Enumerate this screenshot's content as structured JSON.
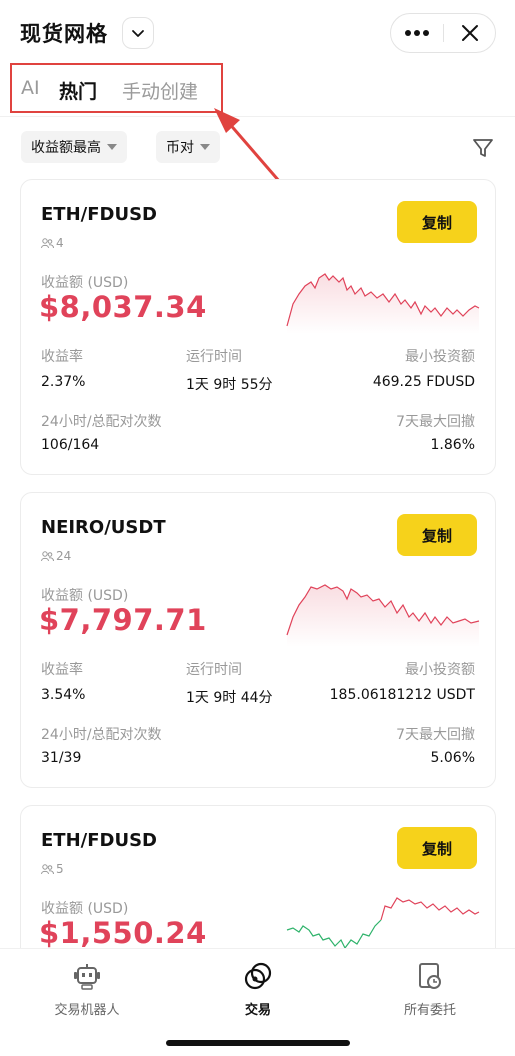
{
  "header": {
    "title": "现货网格",
    "icons": [
      "chevron-down-icon",
      "more-icon",
      "close-icon"
    ]
  },
  "tabs": [
    {
      "label": "AI",
      "active": false
    },
    {
      "label": "热门",
      "active": true
    },
    {
      "label": "手动创建",
      "active": false
    }
  ],
  "filters": {
    "sort_label": "收益额最高",
    "pair_label": "币对",
    "filter_icon": "filter-icon"
  },
  "cards": [
    {
      "pair": "ETH/FDUSD",
      "users": "4",
      "copy_label": "复制",
      "pnl_label": "收益额 (USD)",
      "pnl_value": "$8,037.34",
      "roi_label": "收益率",
      "roi_value": "2.37%",
      "runtime_label": "运行时间",
      "runtime_value": "1天 9时 55分",
      "min_invest_label": "最小投资额",
      "min_invest_value": "469.25 FDUSD",
      "trades_label": "24小时/总配对次数",
      "trades_value": "106/164",
      "drawdown_label": "7天最大回撤",
      "drawdown_value": "1.86%"
    },
    {
      "pair": "NEIRO/USDT",
      "users": "24",
      "copy_label": "复制",
      "pnl_label": "收益额 (USD)",
      "pnl_value": "$7,797.71",
      "roi_label": "收益率",
      "roi_value": "3.54%",
      "runtime_label": "运行时间",
      "runtime_value": "1天 9时 44分",
      "min_invest_label": "最小投资额",
      "min_invest_value": "185.06181212 USDT",
      "trades_label": "24小时/总配对次数",
      "trades_value": "31/39",
      "drawdown_label": "7天最大回撤",
      "drawdown_value": "5.06%"
    },
    {
      "pair": "ETH/FDUSD",
      "users": "5",
      "copy_label": "复制",
      "pnl_label": "收益额 (USD)",
      "pnl_value": "$1,550.24"
    }
  ],
  "bottom_nav": [
    {
      "label": "交易机器人",
      "icon": "robot-icon",
      "active": false
    },
    {
      "label": "交易",
      "icon": "trade-icon",
      "active": true
    },
    {
      "label": "所有委托",
      "icon": "orders-icon",
      "active": false
    }
  ],
  "colors": {
    "accent_yellow": "#f6d21b",
    "profit_red": "#e0435a",
    "annotation_red": "#e0433f",
    "chart_green": "#2fb36b"
  }
}
